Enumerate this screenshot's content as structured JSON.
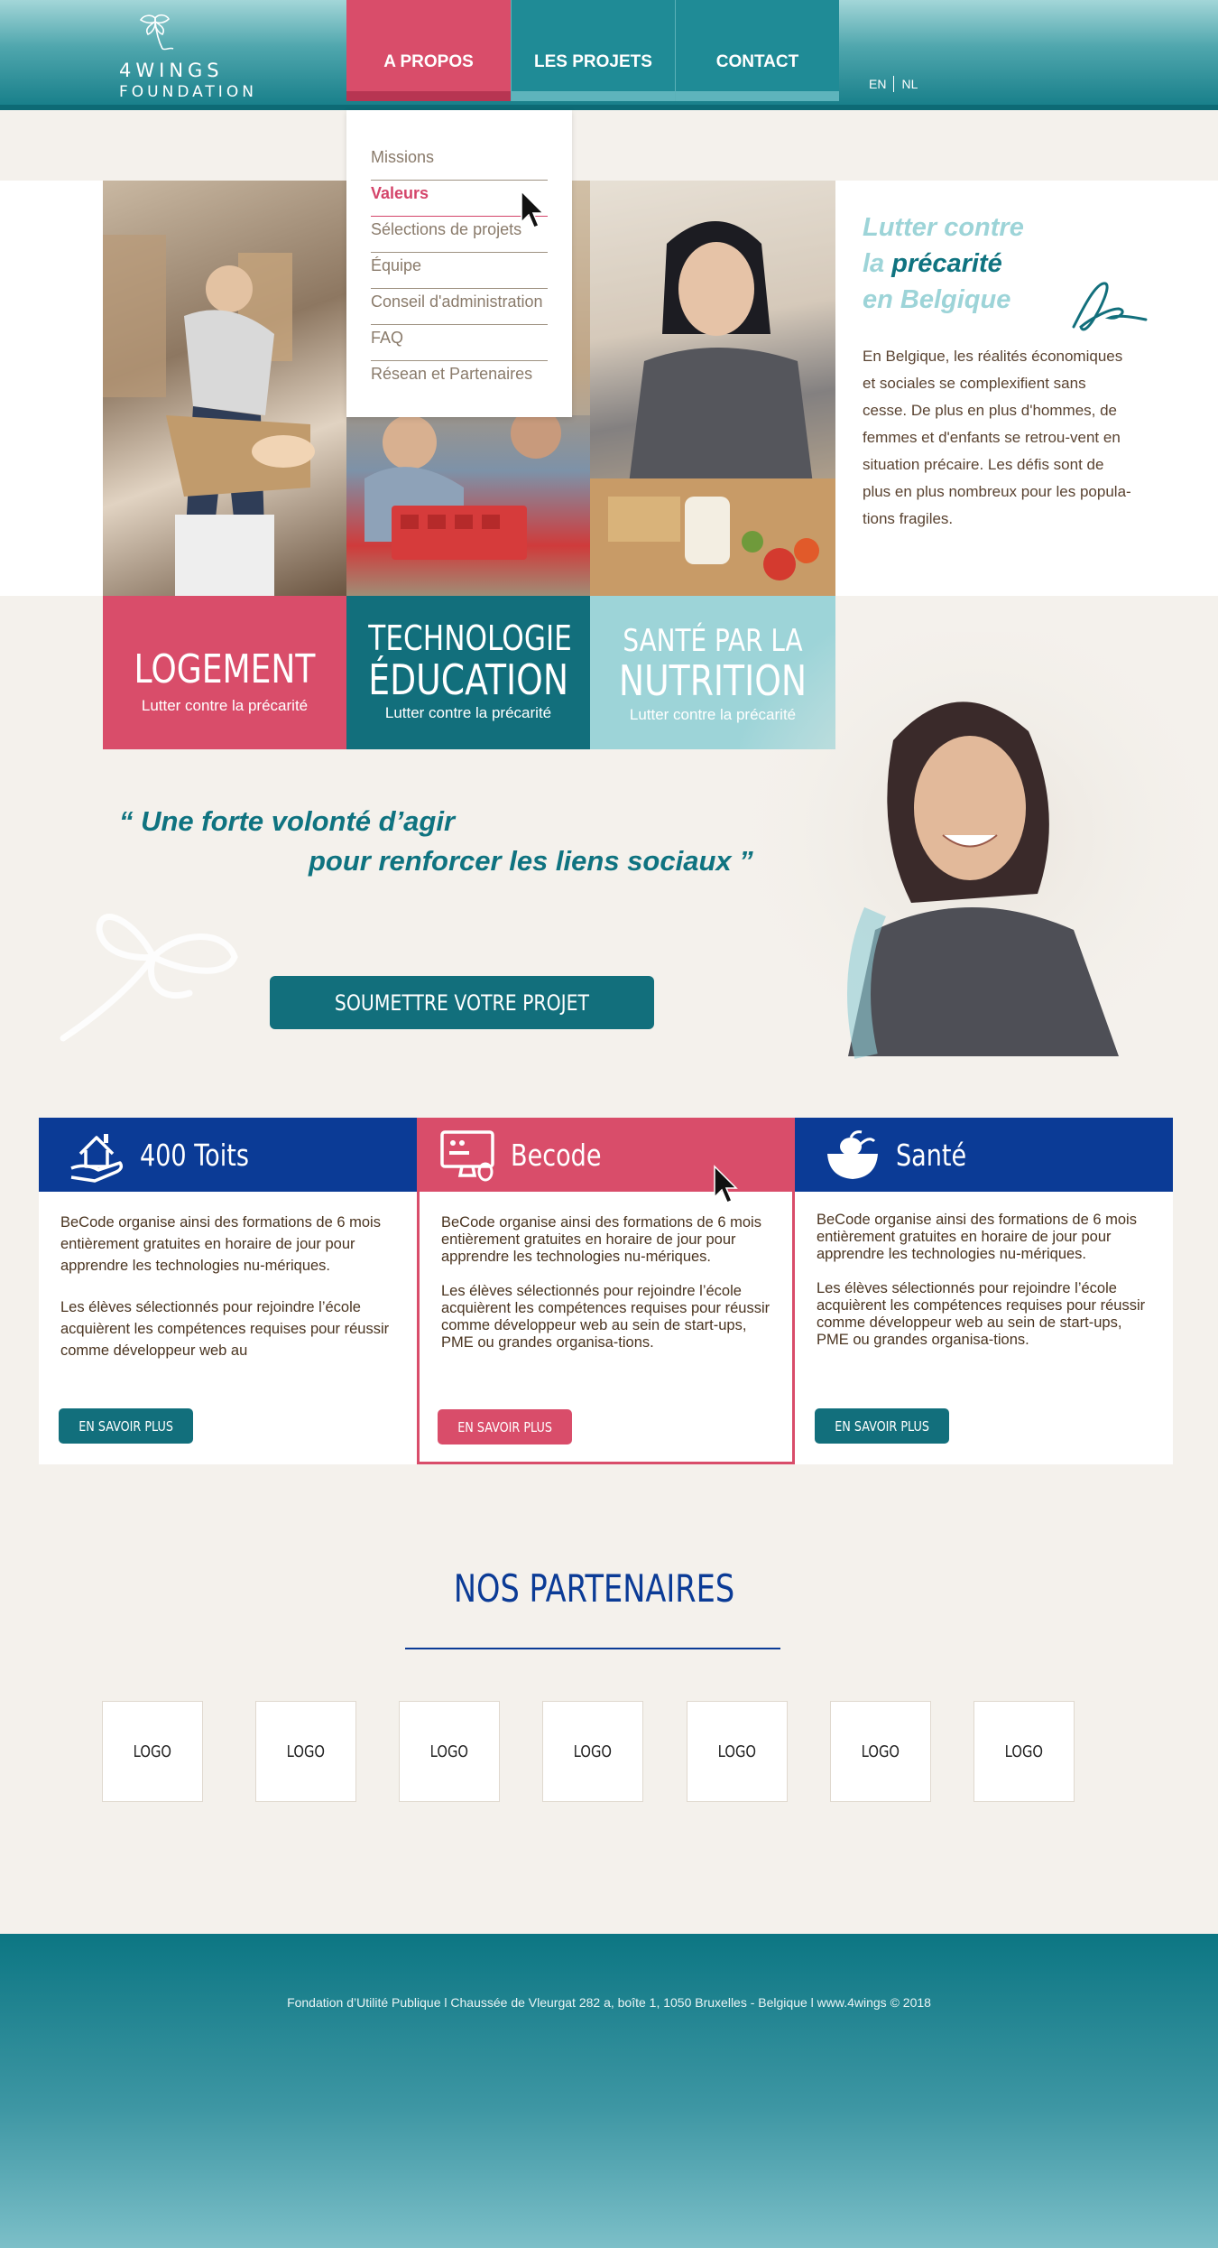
{
  "brand": {
    "name_line1": "4WINGS",
    "name_line2": "FOUNDATION"
  },
  "nav": {
    "items": [
      {
        "label": "A PROPOS",
        "active": true
      },
      {
        "label": "LES PROJETS",
        "active": false
      },
      {
        "label": "CONTACT",
        "active": false
      }
    ],
    "lang": [
      "EN",
      "NL"
    ]
  },
  "dropdown": {
    "items": [
      {
        "label": "Missions"
      },
      {
        "label": "Valeurs",
        "active": true
      },
      {
        "label": "Sélections de projets"
      },
      {
        "label": "Équipe"
      },
      {
        "label": "Conseil d'administration"
      },
      {
        "label": "FAQ"
      },
      {
        "label": "Résean et Partenaires"
      }
    ]
  },
  "intro": {
    "title_l1": "Lutter contre",
    "title_l2a": "la ",
    "title_l2b": "précarité",
    "title_l3": "en Belgique",
    "text": "En Belgique, les réalités économiques et sociales se complexifient sans cesse. De plus en plus d'hommes, de femmes et d'enfants se retrou-vent en situation précaire. Les défis sont de plus en plus nombreux pour les popula-tions fragiles."
  },
  "tiles": [
    {
      "title": "LOGEMENT",
      "subtitle": "Lutter contre la précarité"
    },
    {
      "title_l1": "TECHNOLOGIE",
      "title_l2": "ÉDUCATION",
      "subtitle": "Lutter contre la précarité"
    },
    {
      "title_l1": "SANTÉ PAR LA",
      "title_l2": "NUTRITION",
      "subtitle": "Lutter contre la précarité"
    }
  ],
  "quote": {
    "line1": "“ Une forte volonté d’agir",
    "line2": "pour renforcer les liens sociaux ”"
  },
  "submit_label": "SOUMETTRE VOTRE PROJET",
  "cards": [
    {
      "title": "400 Toits",
      "icon": "house-hand-icon",
      "p1": "BeCode organise ainsi des formations de 6 mois entièrement gratuites en horaire de jour pour apprendre les technologies nu-mériques.",
      "p2": "Les élèves sélectionnés pour rejoindre l’école acquièrent les compétences requises pour réussir comme développeur web au",
      "button": "EN SAVOIR PLUS"
    },
    {
      "title": "Becode",
      "icon": "computer-screen-icon",
      "p1": "BeCode organise ainsi des formations de 6 mois entièrement gratuites en horaire de jour pour apprendre les technologies nu-mériques.",
      "p2": "Les élèves sélectionnés pour rejoindre l’école acquièrent les compétences requises pour réussir comme développeur web au sein de start-ups, PME ou grandes organisa-tions.",
      "button": "EN SAVOIR PLUS"
    },
    {
      "title": "Santé",
      "icon": "food-bowl-icon",
      "p1": "BeCode organise ainsi des formations de 6 mois entièrement gratuites en horaire de jour pour apprendre les technologies nu-mériques.",
      "p2": "Les élèves sélectionnés pour rejoindre l’école acquièrent les compétences requises pour réussir comme développeur web au sein de start-ups, PME ou grandes organisa-tions.",
      "button": "EN SAVOIR PLUS"
    }
  ],
  "partners": {
    "title": "NOS PARTENAIRES",
    "logos": [
      "LOGO",
      "LOGO",
      "LOGO",
      "LOGO",
      "LOGO",
      "LOGO",
      "LOGO"
    ]
  },
  "footer": {
    "text": "Fondation d’Utilité Publique  l Chaussée de Vleurgat 282 a, boîte 1, 1050 Bruxelles - Belgique l www.4wings © 2018"
  },
  "colors": {
    "teal": "#126f7c",
    "pink": "#d94d6a",
    "light_teal": "#9dd4d8",
    "navy": "#0b3b96",
    "cream": "#f4f1ec"
  }
}
